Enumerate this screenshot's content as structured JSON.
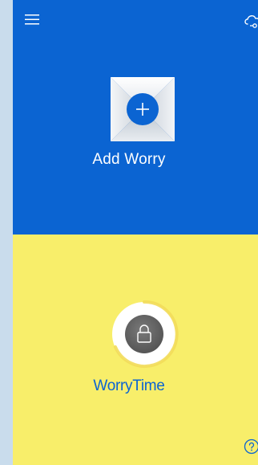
{
  "top": {
    "add_label": "Add Worry",
    "background": "#0b64d2"
  },
  "bottom": {
    "worrytime_label": "WorryTime",
    "background": "#f8ee6a"
  },
  "icons": {
    "menu": "hamburger-menu-icon",
    "cloud": "cloud-sync-icon",
    "add": "plus-icon",
    "lock": "lock-icon",
    "help": "question-mark-icon"
  },
  "colors": {
    "accent_blue": "#0b64d2",
    "yellow": "#f8ee6a",
    "lock_gray": "#6b6b6b"
  }
}
